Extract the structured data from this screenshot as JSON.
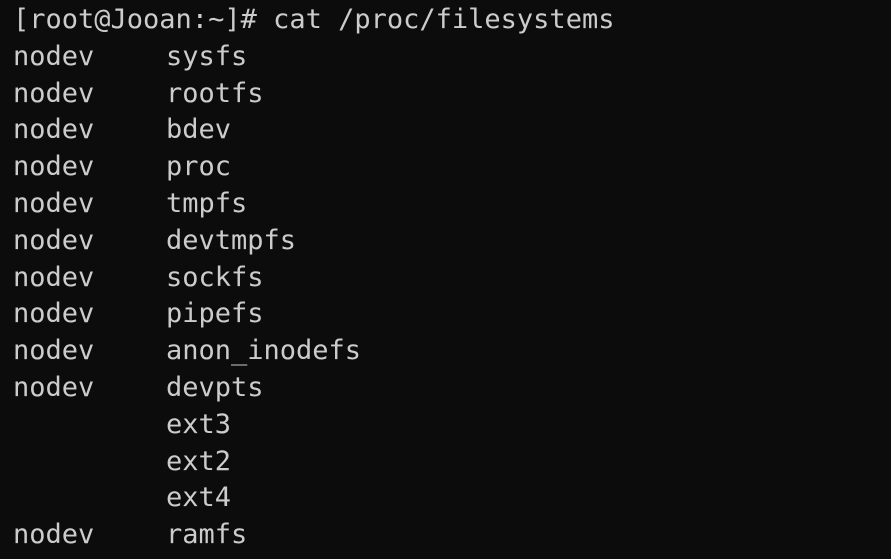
{
  "terminal": {
    "prompt": "[root@Jooan:~]# ",
    "command": "cat /proc/filesystems",
    "rows": [
      {
        "flag": "nodev",
        "fs": "sysfs"
      },
      {
        "flag": "nodev",
        "fs": "rootfs"
      },
      {
        "flag": "nodev",
        "fs": "bdev"
      },
      {
        "flag": "nodev",
        "fs": "proc"
      },
      {
        "flag": "nodev",
        "fs": "tmpfs"
      },
      {
        "flag": "nodev",
        "fs": "devtmpfs"
      },
      {
        "flag": "nodev",
        "fs": "sockfs"
      },
      {
        "flag": "nodev",
        "fs": "pipefs"
      },
      {
        "flag": "nodev",
        "fs": "anon_inodefs"
      },
      {
        "flag": "nodev",
        "fs": "devpts"
      },
      {
        "flag": "",
        "fs": "ext3"
      },
      {
        "flag": "",
        "fs": "ext2"
      },
      {
        "flag": "",
        "fs": "ext4"
      },
      {
        "flag": "nodev",
        "fs": "ramfs"
      }
    ]
  },
  "colors": {
    "background": "#0c0c0c",
    "text": "#cccccc"
  }
}
